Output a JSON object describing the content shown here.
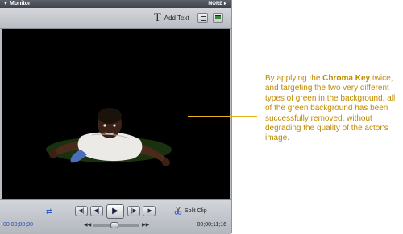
{
  "window": {
    "title": "Monitor",
    "more_label": "MORE"
  },
  "toolbar": {
    "add_text_label": "Add Text",
    "icons": [
      "text-tool-icon",
      "safe-margin-icon",
      "render-icon"
    ]
  },
  "transport": {
    "current_time": "00;00;00;00",
    "total_time": "00;00;11;16",
    "split_clip_label": "Split Clip",
    "buttons": [
      "go-to-start",
      "step-back",
      "play",
      "step-forward",
      "go-to-end"
    ]
  },
  "callout": {
    "text_before": "By applying the ",
    "bold_text": "Chroma Key",
    "text_after": " twice, and targeting the two very different types of green in the background, all of the green background has been successfully removed, without degrading the quality of the actor's image."
  },
  "colors": {
    "callout_text": "#c08b00",
    "callout_line": "#e8b21a",
    "timecode": "#1f4fb3"
  }
}
